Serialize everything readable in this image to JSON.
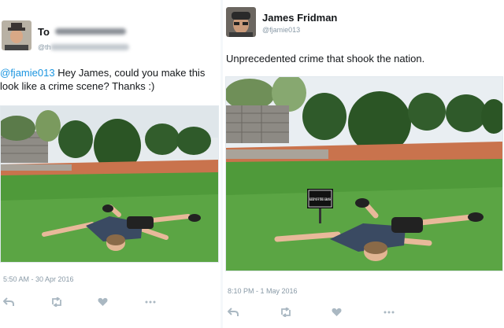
{
  "left_tweet": {
    "name": "To",
    "handle": "@th",
    "mention": "@fjamie013",
    "text": " Hey James, could you make this look like a crime scene? Thanks :)",
    "timestamp": "5:50 AM - 30 Apr 2016",
    "actions": [
      "reply-icon",
      "retweet-icon",
      "like-icon",
      "more-icon"
    ]
  },
  "right_tweet": {
    "name": "James Fridman",
    "handle": "@fjamie013",
    "text": "Unprecedented crime that shook the nation.",
    "sign_text": "KEEP OFF THE GRASS",
    "timestamp": "8:10 PM - 1 May 2016",
    "actions": [
      "reply-icon",
      "retweet-icon",
      "like-icon",
      "more-icon"
    ]
  },
  "colors": {
    "link": "#1b95e0",
    "grass": "#4f9a3a",
    "sky": "#e9eef2",
    "shirt": "#3a4a62"
  }
}
